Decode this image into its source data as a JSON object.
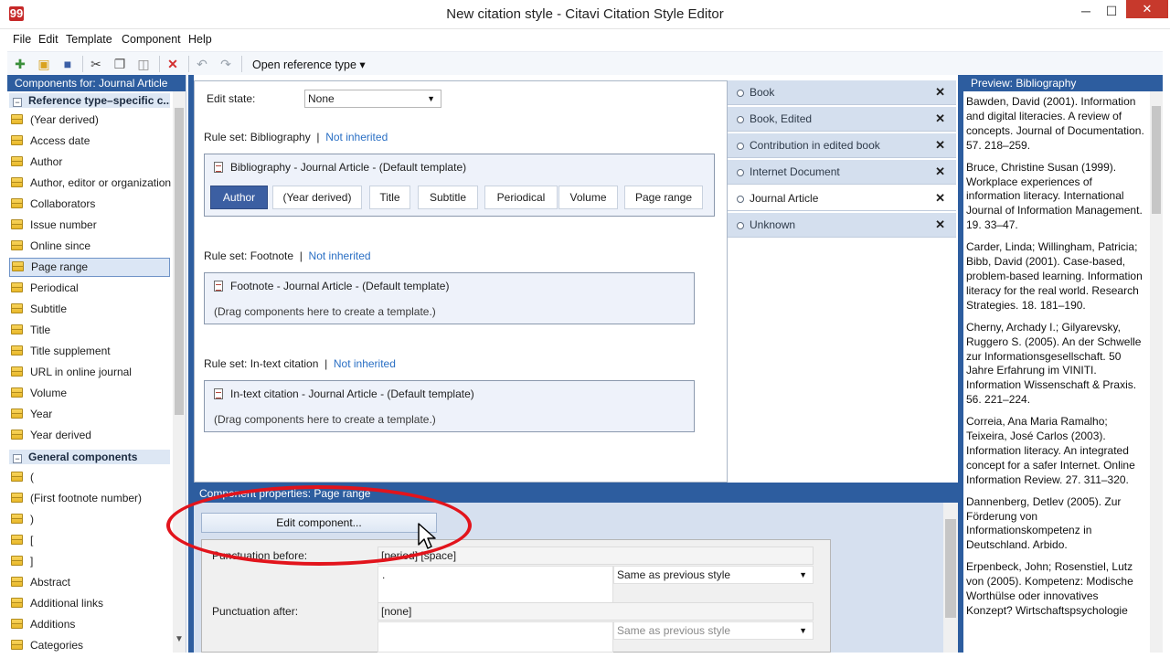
{
  "window": {
    "title": "New citation style - Citavi Citation Style Editor",
    "app_icon_glyph": "99",
    "minimize": "─",
    "maximize": "☐",
    "close": "✕"
  },
  "menu": [
    "File",
    "Edit",
    "Template",
    "Component",
    "Help"
  ],
  "toolbar": {
    "open_reference_type": "Open reference type ▾"
  },
  "left_panel": {
    "header": "Components for: Journal Article",
    "group1": "Reference type–specific c...",
    "group1_items": [
      "(Year derived)",
      "Access date",
      "Author",
      "Author, editor or organization",
      "Collaborators",
      "Issue number",
      "Online since",
      "Page range",
      "Periodical",
      "Subtitle",
      "Title",
      "Title supplement",
      "URL in online journal",
      "Volume",
      "Year",
      "Year derived"
    ],
    "selected_item": "Page range",
    "group2": "General components",
    "group2_items": [
      "(",
      "(First footnote number)",
      ")",
      "[",
      "]",
      "Abstract",
      "Additional links",
      "Additions",
      "Categories"
    ]
  },
  "editor": {
    "edit_state_label": "Edit state:",
    "edit_state_value": "None",
    "bibliography": {
      "rule_label": "Rule set: Bibliography",
      "sep": "|",
      "link": "Not inherited",
      "template_title": "Bibliography - Journal Article - (Default template)",
      "chips": [
        "Author",
        "(Year derived)",
        "Title",
        "Subtitle",
        "Periodical",
        "Volume",
        "Page range"
      ]
    },
    "footnote": {
      "rule_label": "Rule set: Footnote",
      "sep": "|",
      "link": "Not inherited",
      "template_title": "Footnote - Journal Article - (Default template)",
      "hint": "(Drag components here to create a template.)"
    },
    "intext": {
      "rule_label": "Rule set: In-text citation",
      "sep": "|",
      "link": "Not inherited",
      "template_title": "In-text citation - Journal Article - (Default template)",
      "hint": "(Drag components here to create a template.)"
    }
  },
  "reference_types": [
    {
      "label": "Book",
      "selected": false
    },
    {
      "label": "Book, Edited",
      "selected": false
    },
    {
      "label": "Contribution in edited book",
      "selected": false
    },
    {
      "label": "Internet Document",
      "selected": false
    },
    {
      "label": "Journal Article",
      "selected": true
    },
    {
      "label": "Unknown",
      "selected": false
    }
  ],
  "ref_close_glyph": "✕",
  "properties": {
    "header": "Component properties:  Page range",
    "edit_button": "Edit component...",
    "punct_before_label": "Punctuation before:",
    "punct_before_code": "[period] [space]",
    "punct_before_value": ".",
    "punct_before_mode": "Same as previous style",
    "punct_after_label": "Punctuation after:",
    "punct_after_code": "[none]",
    "punct_after_mode": "Same as previous style"
  },
  "preview": {
    "header": "Preview: Bibliography",
    "entries": [
      "Bawden, David (2001). Information and digital literacies. A review of concepts. Journal of Documentation. 57. 218–259.",
      "Bruce, Christine Susan (1999). Workplace experiences of information literacy. International Journal of Information Management. 19. 33–47.",
      "Carder, Linda; Willingham, Patricia; Bibb, David (2001). Case-based, problem-based learning. Information literacy for the real world. Research Strategies. 18. 181–190.",
      "Cherny, Archady I.; Gilyarevsky, Ruggero S. (2005). An der Schwelle zur Informationsgesellschaft. 50 Jahre Erfahrung im VINITI. Information Wissenschaft & Praxis. 56. 221–224.",
      "Correia, Ana Maria Ramalho; Teixeira, José Carlos (2003). Information literacy. An integrated concept for a safer Internet. Online Information Review. 27. 311–320.",
      "Dannenberg, Detlev (2005). Zur Förderung von Informationskompetenz in Deutschland. Arbido.",
      "Erpenbeck, John; Rosenstiel, Lutz von (2005). Kompetenz: Modische Worthülse oder innovatives Konzept? Wirtschaftspsychologie"
    ]
  },
  "colors": {
    "accent_blue": "#2d5d9f",
    "annotation_red": "#e2141c",
    "link": "#2a6fc4"
  }
}
